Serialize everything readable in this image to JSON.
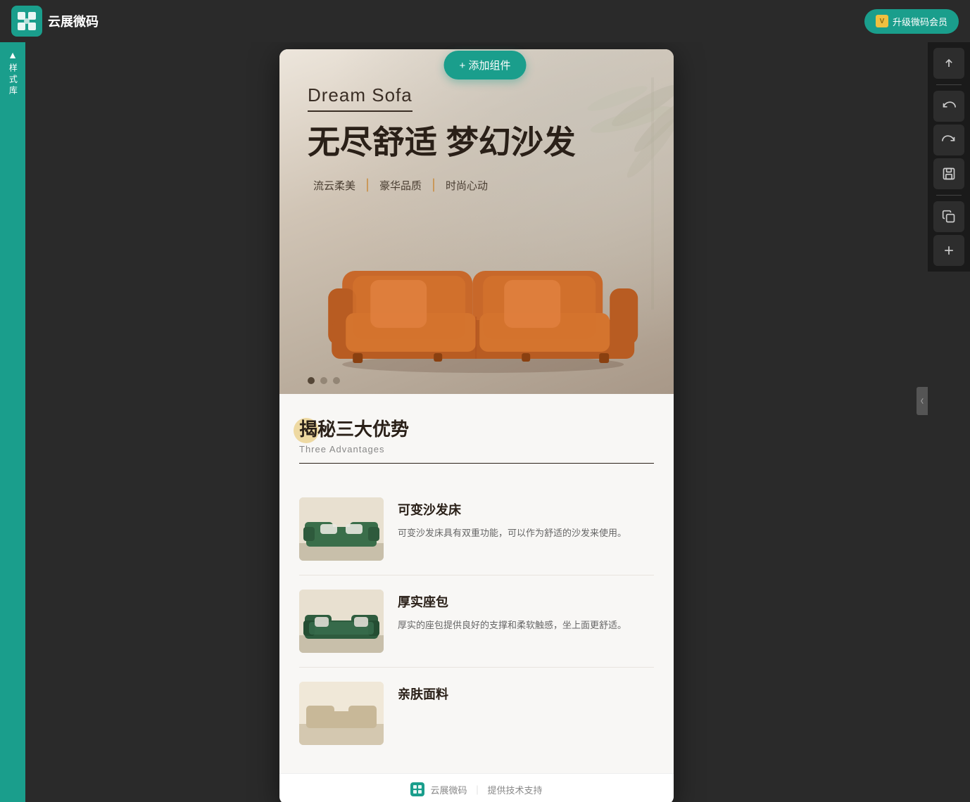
{
  "app": {
    "logo_text": "云展微码",
    "upgrade_btn": "升级微码会员"
  },
  "sidebar": {
    "label": "样式库"
  },
  "toolbar": {
    "upload_title": "上传",
    "undo_title": "撤销",
    "redo_title": "重做",
    "save_title": "保存",
    "copy_title": "复制",
    "add_title": "添加"
  },
  "add_component": {
    "label": "+ 添加组件"
  },
  "hero": {
    "en_title": "Dream Sofa",
    "cn_title": "无尽舒适 梦幻沙发",
    "tag1": "流云柔美",
    "tag2": "豪华品质",
    "tag3": "时尚心动",
    "dots": 3,
    "active_dot": 0
  },
  "section": {
    "cn_title": "揭秘三大优势",
    "en_title": "Three Advantages",
    "features": [
      {
        "title": "可变沙发床",
        "desc": "可变沙发床具有双重功能，可以作为舒适的沙发来使用。",
        "img_bg": "#b5c4b1"
      },
      {
        "title": "厚实座包",
        "desc": "厚实的座包提供良好的支撑和柔软触感，坐上面更舒适。",
        "img_bg": "#4a7c59"
      },
      {
        "title": "亲肤面料",
        "desc": "",
        "img_bg": "#d4c4a8"
      }
    ]
  },
  "footer": {
    "logo_text": "云展微码",
    "sep": "｜",
    "support_text": "提供技术支持"
  }
}
